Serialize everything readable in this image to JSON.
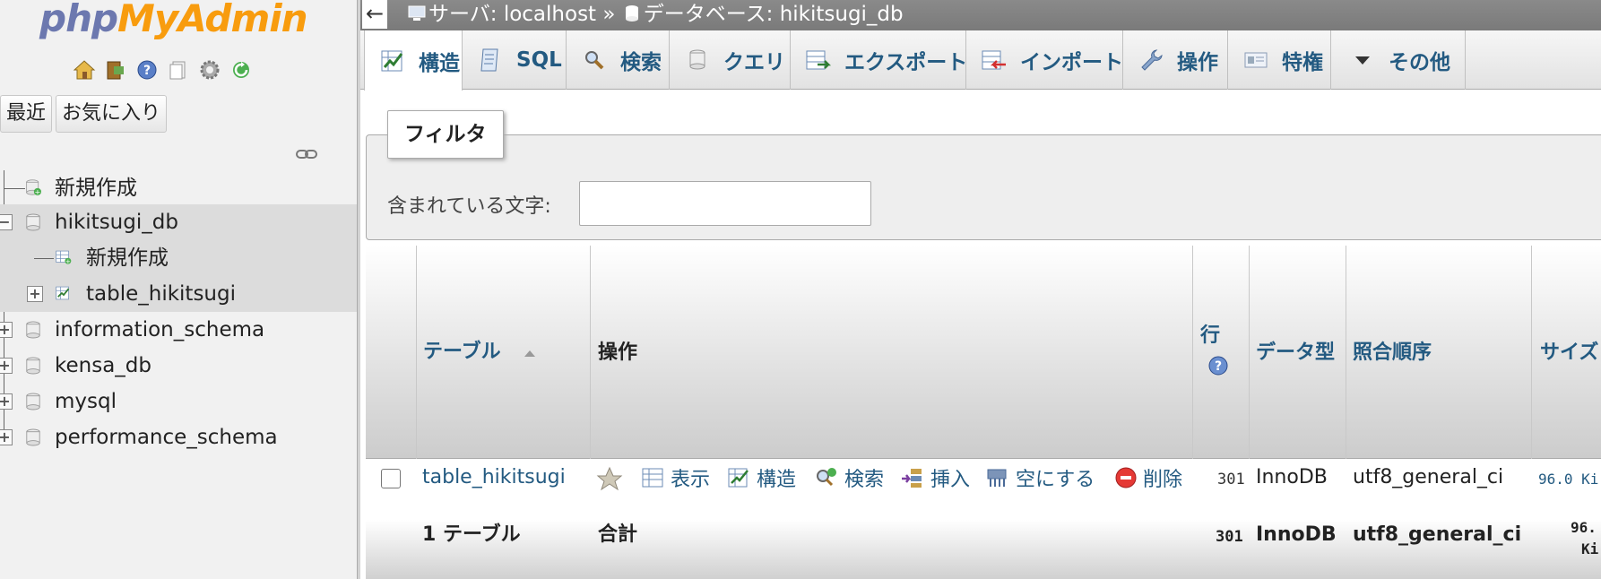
{
  "nav": {
    "logo_php": "php",
    "logo_myadmin": "MyAdmin",
    "icons": [
      "home-icon",
      "exit-icon",
      "help-icon",
      "documentation-icon",
      "settings-icon",
      "reload-icon"
    ],
    "tabs": [
      "最近",
      "お気に入り"
    ],
    "tree": [
      {
        "label": "新規作成",
        "icon": "new-database-icon",
        "level": 0
      },
      {
        "label": "hikitsugi_db",
        "icon": "database-icon",
        "level": 0,
        "expanded": true,
        "selected": true
      },
      {
        "label": "新規作成",
        "icon": "new-table-icon",
        "level": 1
      },
      {
        "label": "table_hikitsugi",
        "icon": "table-icon",
        "level": 1
      },
      {
        "label": "information_schema",
        "icon": "database-icon",
        "level": 0
      },
      {
        "label": "kensa_db",
        "icon": "database-icon",
        "level": 0
      },
      {
        "label": "mysql",
        "icon": "database-icon",
        "level": 0
      },
      {
        "label": "performance_schema",
        "icon": "database-icon",
        "level": 0
      }
    ]
  },
  "breadcrumb": {
    "server_label": "サーバ: localhost",
    "separator": "»",
    "database_label": "データベース: hikitsugi_db"
  },
  "tabs": [
    {
      "label": "構造",
      "icon": "structure-icon",
      "active": true
    },
    {
      "label": "SQL",
      "icon": "sql-icon"
    },
    {
      "label": "検索",
      "icon": "search-icon"
    },
    {
      "label": "クエリ",
      "icon": "query-icon"
    },
    {
      "label": "エクスポート",
      "icon": "export-icon"
    },
    {
      "label": "インポート",
      "icon": "import-icon"
    },
    {
      "label": "操作",
      "icon": "operations-icon"
    },
    {
      "label": "特権",
      "icon": "privileges-icon"
    },
    {
      "label": "その他",
      "icon": "chevron-down-icon"
    }
  ],
  "filter": {
    "legend": "フィルタ",
    "label": "含まれている文字:",
    "value": ""
  },
  "table": {
    "headers": {
      "table": "テーブル",
      "actions": "操作",
      "rows": "行",
      "type": "データ型",
      "collation": "照合順序",
      "size": "サイズ"
    },
    "rows": [
      {
        "name": "table_hikitsugi",
        "actions": [
          "表示",
          "構造",
          "検索",
          "挿入",
          "空にする",
          "削除"
        ],
        "rows": "301",
        "type": "InnoDB",
        "collation": "utf8_general_ci",
        "size": "96.0 Ki"
      }
    ],
    "footer": {
      "count": "1 テーブル",
      "label": "合計",
      "rows": "301",
      "type": "InnoDB",
      "collation": "utf8_general_ci",
      "size_line1": "96.",
      "size_line2": "Ki"
    }
  }
}
